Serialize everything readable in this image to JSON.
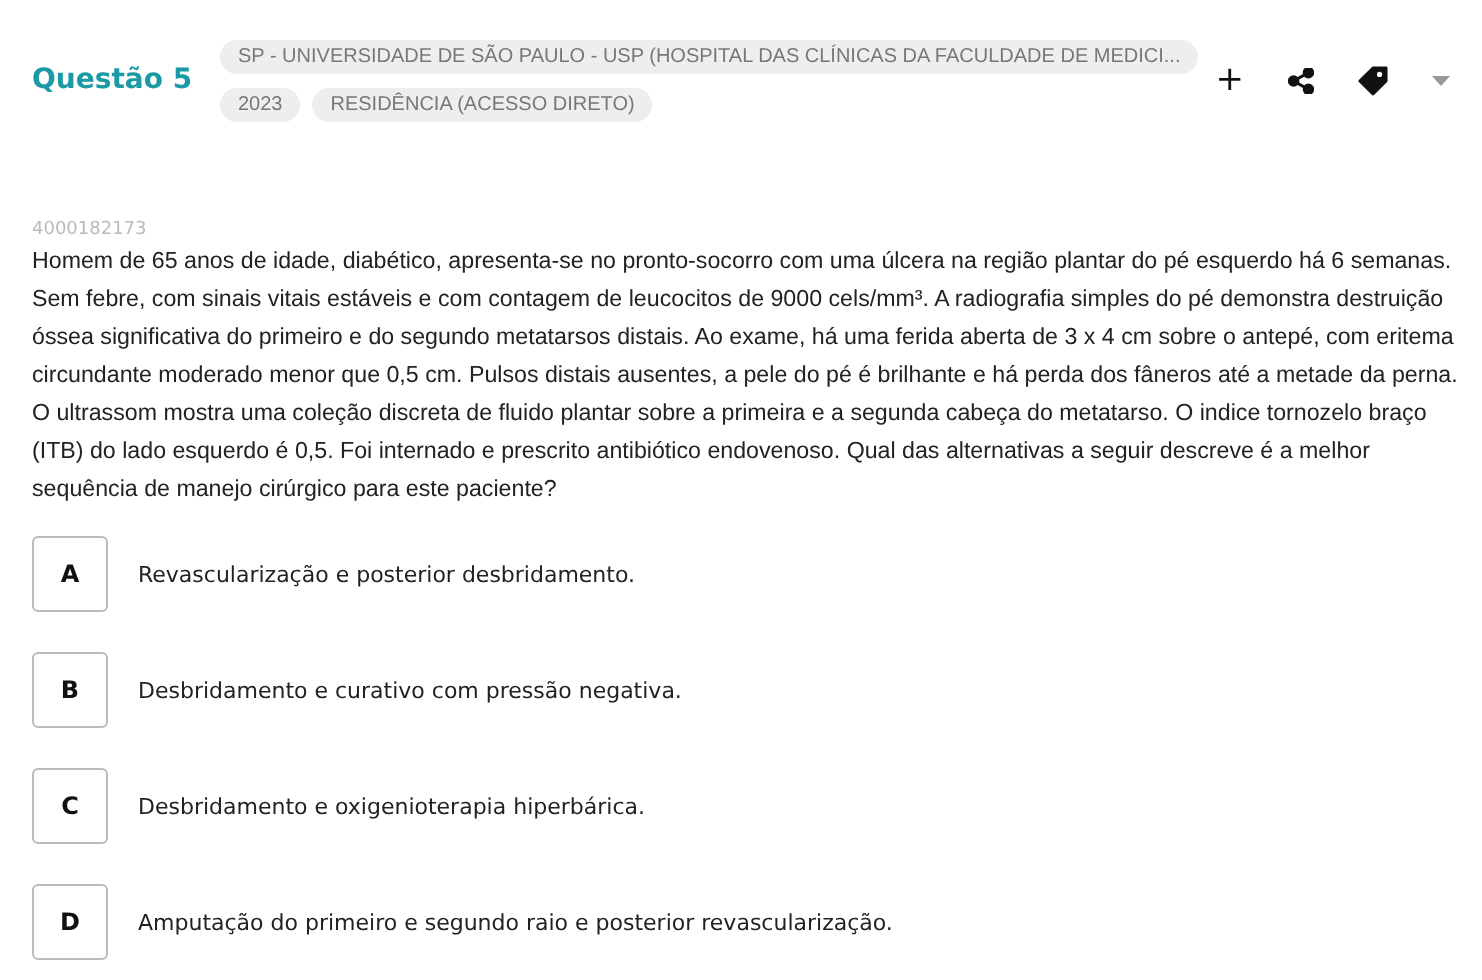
{
  "header": {
    "title": "Questão 5",
    "tags": [
      [
        "SP - UNIVERSIDADE DE SÃO PAULO - USP (HOSPITAL DAS CLÍNICAS DA FACULDADE DE MEDICI..."
      ],
      [
        "2023",
        "RESIDÊNCIA (ACESSO DIRETO)"
      ]
    ],
    "add": "+"
  },
  "question": {
    "id": "4000182173",
    "text": "Homem de 65 anos de idade, diabético, apresenta-se no pronto-socorro com uma úlcera na região plantar do pé esquerdo há 6 semanas. Sem febre, com sinais vitais estáveis e com contagem de leucocitos de 9000 cels/mm³. A radiografia simples do pé demonstra destruição óssea significativa do primeiro e do segundo metatarsos distais. Ao exame, há uma ferida aberta de 3 x 4 cm sobre o antepé, com eritema circundante moderado menor que 0,5 cm. Pulsos distais ausentes, a pele do pé é brilhante e há perda dos fâneros até a metade da perna. O ultrassom mostra uma coleção discreta de fluido plantar sobre a primeira e a segunda cabeça do metatarso. O indice tornozelo braço (ITB) do lado esquerdo é 0,5. Foi internado e prescrito antibiótico endovenoso. Qual das alternativas a seguir descreve é a melhor sequência de manejo cirúrgico para este paciente?"
  },
  "options": [
    {
      "letter": "A",
      "text": "Revascularização e posterior desbridamento.",
      "selected": false
    },
    {
      "letter": "B",
      "text": "Desbridamento e curativo com pressão negativa.",
      "selected": false
    },
    {
      "letter": "C",
      "text": "Desbridamento e oxigenioterapia hiperbárica.",
      "selected": false
    },
    {
      "letter": "D",
      "text": "Amputação do primeiro e segundo raio e posterior revascularização.",
      "selected": false
    }
  ]
}
